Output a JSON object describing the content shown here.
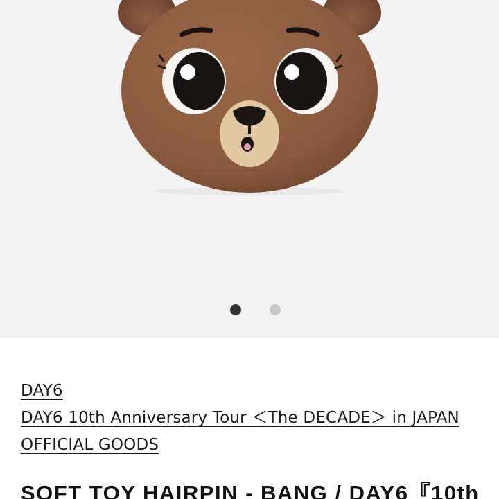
{
  "gallery": {
    "image_alt": "Brown bear plush face hairpin",
    "current_slide": 1,
    "total_slides": 2,
    "colors": {
      "background": "#f3f3f3",
      "plush_brown": "#8a5a3e",
      "muzzle": "#e2c9a4",
      "dot_active": "#333333",
      "dot_inactive": "#c7c7c7"
    }
  },
  "breadcrumb": {
    "artist_link": "DAY6",
    "tour_link": "DAY6 10th Anniversary Tour ＜The DECADE＞ in JAPAN",
    "category_link": "OFFICIAL GOODS"
  },
  "product": {
    "title": "SOFT TOY HAIRPIN - BANG / DAY6『10th"
  }
}
